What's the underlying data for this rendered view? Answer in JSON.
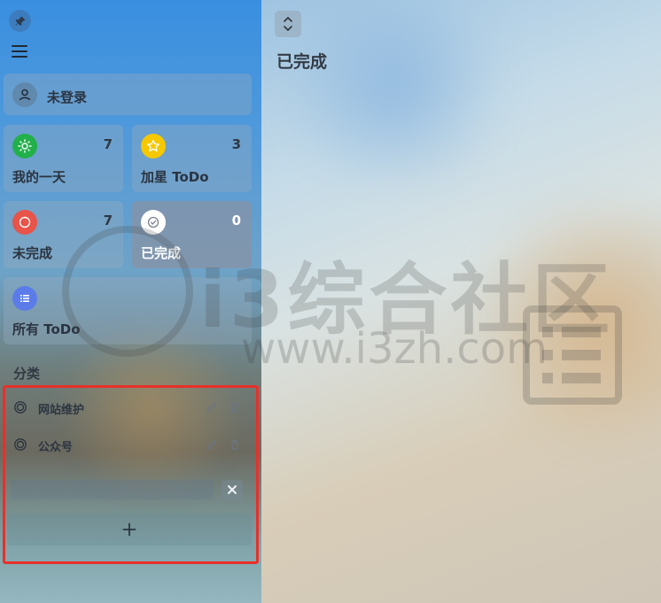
{
  "sidebar": {
    "user": {
      "label": "未登录"
    },
    "tiles": {
      "today": {
        "label": "我的一天",
        "count": "7",
        "color": "#22b04b"
      },
      "starred": {
        "label": "加星 ToDo",
        "count": "3",
        "color": "#f6c800"
      },
      "undone": {
        "label": "未完成",
        "count": "7",
        "color": "#e8534a"
      },
      "done": {
        "label": "已完成",
        "count": "0",
        "color": "#ffffff"
      },
      "all": {
        "label": "所有 ToDo",
        "color": "#5b7ce8"
      }
    },
    "categories_title": "分类",
    "categories": [
      {
        "label": "网站维护"
      },
      {
        "label": "公众号"
      }
    ],
    "new_category": {
      "value": "",
      "placeholder": ""
    }
  },
  "main": {
    "title": "已完成"
  },
  "watermark": {
    "text": "i3综合社区",
    "url": "www.i3zh.com"
  },
  "icons": [
    "pin-icon",
    "menu-icon",
    "user-icon",
    "sun-icon",
    "star-icon",
    "circle-icon",
    "check-circle-icon",
    "list-icon",
    "category-icon",
    "edit-icon",
    "trash-icon",
    "close-icon",
    "plus-icon",
    "expand-collapse-icon"
  ],
  "colors": {
    "highlight": "#e8302a"
  }
}
